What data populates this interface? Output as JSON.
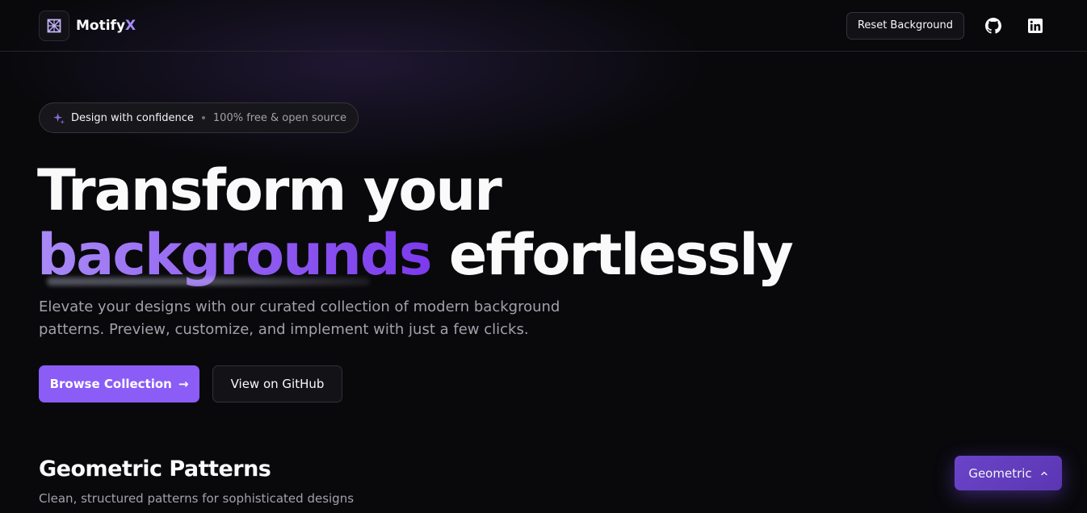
{
  "header": {
    "brand_name": "Motify",
    "brand_accent": "X",
    "reset_label": "Reset Background",
    "github_icon": "github-icon",
    "linkedin_icon": "linkedin-icon"
  },
  "badge": {
    "icon": "sparkles-icon",
    "strong": "Design with confidence",
    "muted": "100% free & open source"
  },
  "hero": {
    "title_line1": "Transform your",
    "title_accent": "backgrounds",
    "title_rest": " effortlessly",
    "subtitle_line1": "Elevate your designs with our curated collection of modern background",
    "subtitle_line2": "patterns. Preview, customize, and implement with just a few clicks.",
    "primary_label": "Browse Collection",
    "primary_arrow": "→",
    "secondary_label": "View on GitHub"
  },
  "section": {
    "title": "Geometric Patterns",
    "subtitle": "Clean, structured patterns for sophisticated designs"
  },
  "float": {
    "label": "Geometric",
    "chevron_icon": "chevron-up-icon"
  },
  "colors": {
    "accent": "#8b5cf6",
    "accent_light": "#a78bfa",
    "background": "#09090c",
    "muted_text": "#a1a1aa"
  }
}
